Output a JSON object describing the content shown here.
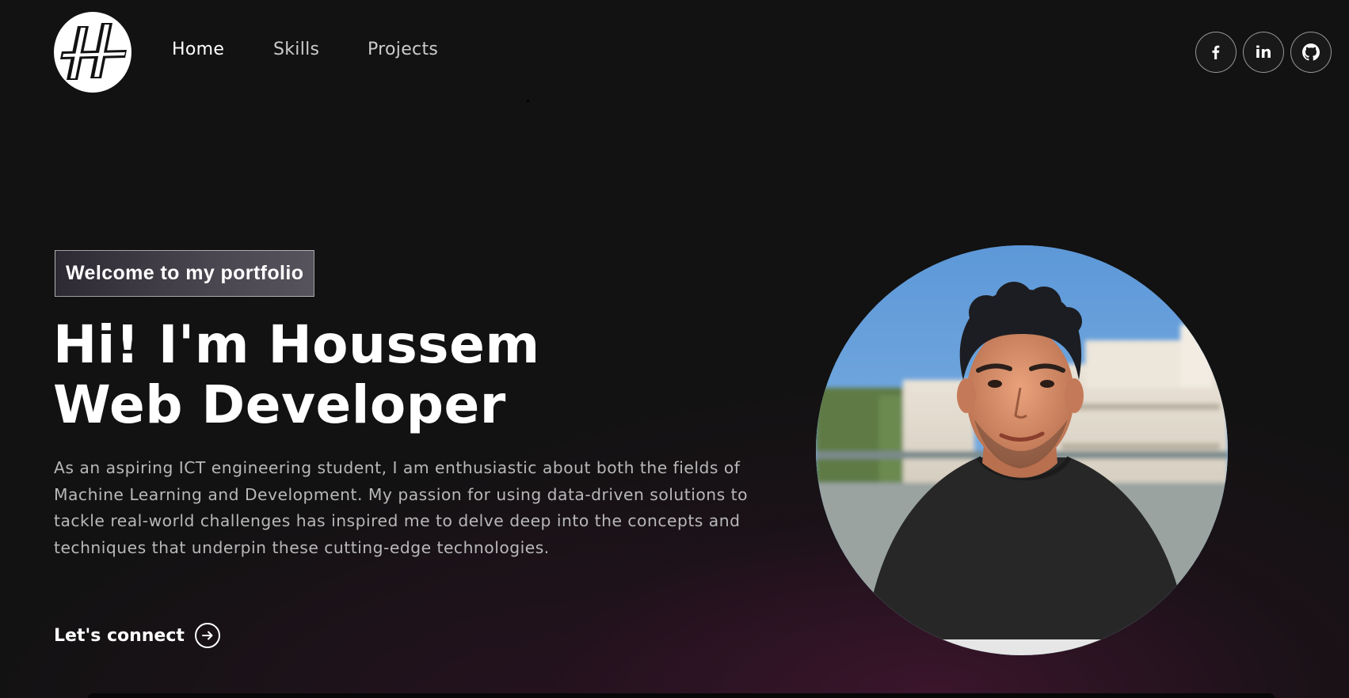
{
  "nav": {
    "logo_icon": "monogram-h-logo",
    "links": [
      {
        "label": "Home",
        "active": true
      },
      {
        "label": "Skills",
        "active": false
      },
      {
        "label": "Projects",
        "active": false
      }
    ],
    "social": [
      {
        "icon": "facebook-icon",
        "glyph": "f"
      },
      {
        "icon": "linkedin-icon",
        "glyph": "in"
      },
      {
        "icon": "github-icon",
        "glyph": ""
      }
    ]
  },
  "hero": {
    "tagline": "Welcome to my portfolio",
    "headline_line1": "Hi! I'm Houssem",
    "headline_line2": "Web Developer",
    "bio": "As an aspiring ICT engineering student, I am enthusiastic about both the fields of Machine Learning and Development. My passion for using data-driven solutions to tackle real-world challenges has inspired me to delve deep into the concepts and techniques that underpin these cutting-edge technologies.",
    "cta_label": "Let's connect",
    "cta_icon": "arrow-right-circle-icon",
    "photo_alt": "profile-photo"
  },
  "colors": {
    "background": "#121212",
    "text": "#ffffff",
    "muted_text": "#b8b8b8",
    "glow": "#481634"
  }
}
